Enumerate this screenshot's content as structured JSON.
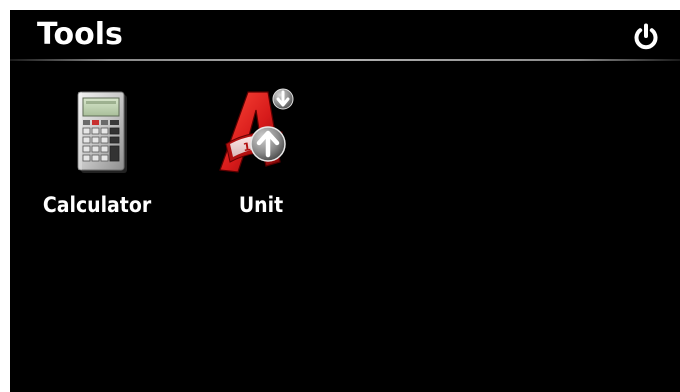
{
  "header": {
    "title": "Tools",
    "power_icon": "power-icon"
  },
  "apps": [
    {
      "label": "Calculator",
      "icon": "calculator-icon"
    },
    {
      "label": "Unit",
      "icon": "unit-converter-icon",
      "icon_text": "120"
    }
  ],
  "colors": {
    "background": "#000000",
    "text": "#ffffff",
    "unit_red": "#d61a1a",
    "badge_gray": "#8c8c8c"
  }
}
